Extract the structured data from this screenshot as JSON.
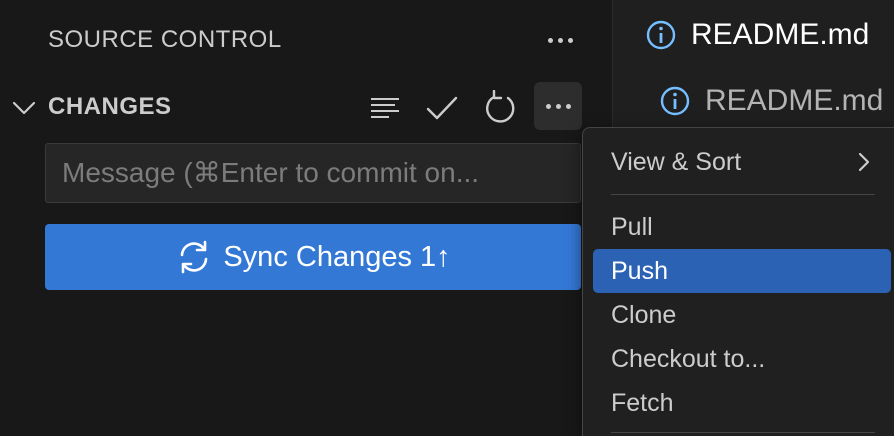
{
  "sidebar": {
    "title": "SOURCE CONTROL",
    "changes_label": "CHANGES",
    "message_placeholder": "Message (⌘Enter to commit on...",
    "sync_button_label": "Sync Changes 1↑"
  },
  "tabs": [
    {
      "label": "README.md",
      "icon": "info-icon",
      "active": true
    },
    {
      "label": "README.md",
      "icon": "info-icon",
      "active": false
    }
  ],
  "menu": {
    "view_sort": "View & Sort",
    "items": [
      "Pull",
      "Push",
      "Clone",
      "Checkout to...",
      "Fetch"
    ],
    "active": "Push"
  },
  "colors": {
    "accent": "#3478d6",
    "menu_highlight": "#2c62b4",
    "background": "#181818"
  }
}
